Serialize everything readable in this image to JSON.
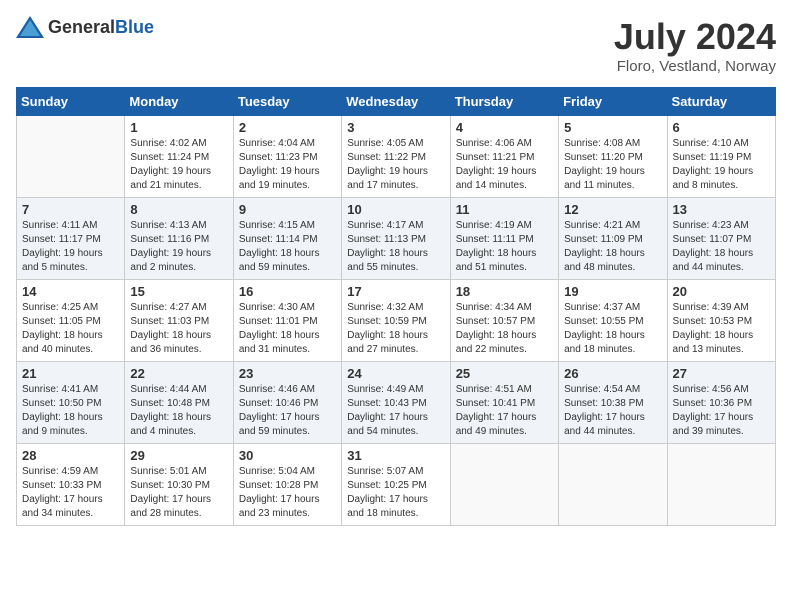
{
  "header": {
    "logo_general": "General",
    "logo_blue": "Blue",
    "month_title": "July 2024",
    "location": "Floro, Vestland, Norway"
  },
  "weekdays": [
    "Sunday",
    "Monday",
    "Tuesday",
    "Wednesday",
    "Thursday",
    "Friday",
    "Saturday"
  ],
  "weeks": [
    [
      {
        "day": "",
        "info": ""
      },
      {
        "day": "1",
        "info": "Sunrise: 4:02 AM\nSunset: 11:24 PM\nDaylight: 19 hours\nand 21 minutes."
      },
      {
        "day": "2",
        "info": "Sunrise: 4:04 AM\nSunset: 11:23 PM\nDaylight: 19 hours\nand 19 minutes."
      },
      {
        "day": "3",
        "info": "Sunrise: 4:05 AM\nSunset: 11:22 PM\nDaylight: 19 hours\nand 17 minutes."
      },
      {
        "day": "4",
        "info": "Sunrise: 4:06 AM\nSunset: 11:21 PM\nDaylight: 19 hours\nand 14 minutes."
      },
      {
        "day": "5",
        "info": "Sunrise: 4:08 AM\nSunset: 11:20 PM\nDaylight: 19 hours\nand 11 minutes."
      },
      {
        "day": "6",
        "info": "Sunrise: 4:10 AM\nSunset: 11:19 PM\nDaylight: 19 hours\nand 8 minutes."
      }
    ],
    [
      {
        "day": "7",
        "info": "Sunrise: 4:11 AM\nSunset: 11:17 PM\nDaylight: 19 hours\nand 5 minutes."
      },
      {
        "day": "8",
        "info": "Sunrise: 4:13 AM\nSunset: 11:16 PM\nDaylight: 19 hours\nand 2 minutes."
      },
      {
        "day": "9",
        "info": "Sunrise: 4:15 AM\nSunset: 11:14 PM\nDaylight: 18 hours\nand 59 minutes."
      },
      {
        "day": "10",
        "info": "Sunrise: 4:17 AM\nSunset: 11:13 PM\nDaylight: 18 hours\nand 55 minutes."
      },
      {
        "day": "11",
        "info": "Sunrise: 4:19 AM\nSunset: 11:11 PM\nDaylight: 18 hours\nand 51 minutes."
      },
      {
        "day": "12",
        "info": "Sunrise: 4:21 AM\nSunset: 11:09 PM\nDaylight: 18 hours\nand 48 minutes."
      },
      {
        "day": "13",
        "info": "Sunrise: 4:23 AM\nSunset: 11:07 PM\nDaylight: 18 hours\nand 44 minutes."
      }
    ],
    [
      {
        "day": "14",
        "info": "Sunrise: 4:25 AM\nSunset: 11:05 PM\nDaylight: 18 hours\nand 40 minutes."
      },
      {
        "day": "15",
        "info": "Sunrise: 4:27 AM\nSunset: 11:03 PM\nDaylight: 18 hours\nand 36 minutes."
      },
      {
        "day": "16",
        "info": "Sunrise: 4:30 AM\nSunset: 11:01 PM\nDaylight: 18 hours\nand 31 minutes."
      },
      {
        "day": "17",
        "info": "Sunrise: 4:32 AM\nSunset: 10:59 PM\nDaylight: 18 hours\nand 27 minutes."
      },
      {
        "day": "18",
        "info": "Sunrise: 4:34 AM\nSunset: 10:57 PM\nDaylight: 18 hours\nand 22 minutes."
      },
      {
        "day": "19",
        "info": "Sunrise: 4:37 AM\nSunset: 10:55 PM\nDaylight: 18 hours\nand 18 minutes."
      },
      {
        "day": "20",
        "info": "Sunrise: 4:39 AM\nSunset: 10:53 PM\nDaylight: 18 hours\nand 13 minutes."
      }
    ],
    [
      {
        "day": "21",
        "info": "Sunrise: 4:41 AM\nSunset: 10:50 PM\nDaylight: 18 hours\nand 9 minutes."
      },
      {
        "day": "22",
        "info": "Sunrise: 4:44 AM\nSunset: 10:48 PM\nDaylight: 18 hours\nand 4 minutes."
      },
      {
        "day": "23",
        "info": "Sunrise: 4:46 AM\nSunset: 10:46 PM\nDaylight: 17 hours\nand 59 minutes."
      },
      {
        "day": "24",
        "info": "Sunrise: 4:49 AM\nSunset: 10:43 PM\nDaylight: 17 hours\nand 54 minutes."
      },
      {
        "day": "25",
        "info": "Sunrise: 4:51 AM\nSunset: 10:41 PM\nDaylight: 17 hours\nand 49 minutes."
      },
      {
        "day": "26",
        "info": "Sunrise: 4:54 AM\nSunset: 10:38 PM\nDaylight: 17 hours\nand 44 minutes."
      },
      {
        "day": "27",
        "info": "Sunrise: 4:56 AM\nSunset: 10:36 PM\nDaylight: 17 hours\nand 39 minutes."
      }
    ],
    [
      {
        "day": "28",
        "info": "Sunrise: 4:59 AM\nSunset: 10:33 PM\nDaylight: 17 hours\nand 34 minutes."
      },
      {
        "day": "29",
        "info": "Sunrise: 5:01 AM\nSunset: 10:30 PM\nDaylight: 17 hours\nand 28 minutes."
      },
      {
        "day": "30",
        "info": "Sunrise: 5:04 AM\nSunset: 10:28 PM\nDaylight: 17 hours\nand 23 minutes."
      },
      {
        "day": "31",
        "info": "Sunrise: 5:07 AM\nSunset: 10:25 PM\nDaylight: 17 hours\nand 18 minutes."
      },
      {
        "day": "",
        "info": ""
      },
      {
        "day": "",
        "info": ""
      },
      {
        "day": "",
        "info": ""
      }
    ]
  ]
}
